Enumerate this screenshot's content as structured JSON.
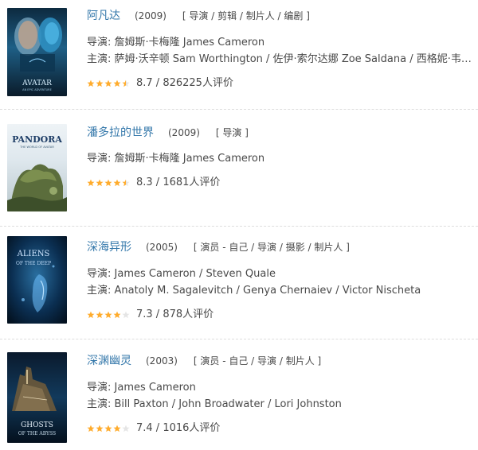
{
  "items": [
    {
      "title": "阿凡达",
      "year": "(2009)",
      "roles": "[ 导演 / 剪辑 / 制片人 / 编剧 ]",
      "director_line": "导演: 詹姆斯·卡梅隆 James Cameron",
      "cast_line": "主演: 萨姆·沃辛顿 Sam Worthington / 佐伊·索尔达娜 Zoe Saldana / 西格妮·韦弗 Sigourney Weaver",
      "rating_text": "8.7 / 826225人评价",
      "stars": 4.5,
      "poster_text": "AVATAR",
      "poster_small": "AN EPIC ADVENTURE"
    },
    {
      "title": "潘多拉的世界",
      "year": "(2009)",
      "roles": "[ 导演 ]",
      "director_line": "导演: 詹姆斯·卡梅隆 James Cameron",
      "cast_line": "",
      "rating_text": "8.3 / 1681人评价",
      "stars": 4.5,
      "poster_text": "PANDORA",
      "poster_small": "THE WORLD OF AVATAR"
    },
    {
      "title": "深海异形",
      "year": "(2005)",
      "roles": "[ 演员 - 自己 / 导演 / 摄影 / 制片人 ]",
      "director_line": "导演: James Cameron / Steven Quale",
      "cast_line": "主演: Anatoly M. Sagalevitch / Genya Chernaiev / Victor Nischeta",
      "rating_text": "7.3 / 878人评价",
      "stars": 4,
      "poster_text": "ALIENS",
      "poster_small": "OF THE DEEP"
    },
    {
      "title": "深渊幽灵",
      "year": "(2003)",
      "roles": "[ 演员 - 自己 / 导演 / 制片人 ]",
      "director_line": "导演: James Cameron",
      "cast_line": "主演: Bill Paxton / John Broadwater / Lori Johnston",
      "rating_text": "7.4 / 1016人评价",
      "stars": 4,
      "poster_text": "GHOSTS",
      "poster_small": "OF THE ABYSS"
    }
  ],
  "colors": {
    "link": "#3377aa",
    "text": "#494949",
    "star": "#ffac2d",
    "star_empty": "#e5e5e5",
    "separator": "#dddddd"
  }
}
